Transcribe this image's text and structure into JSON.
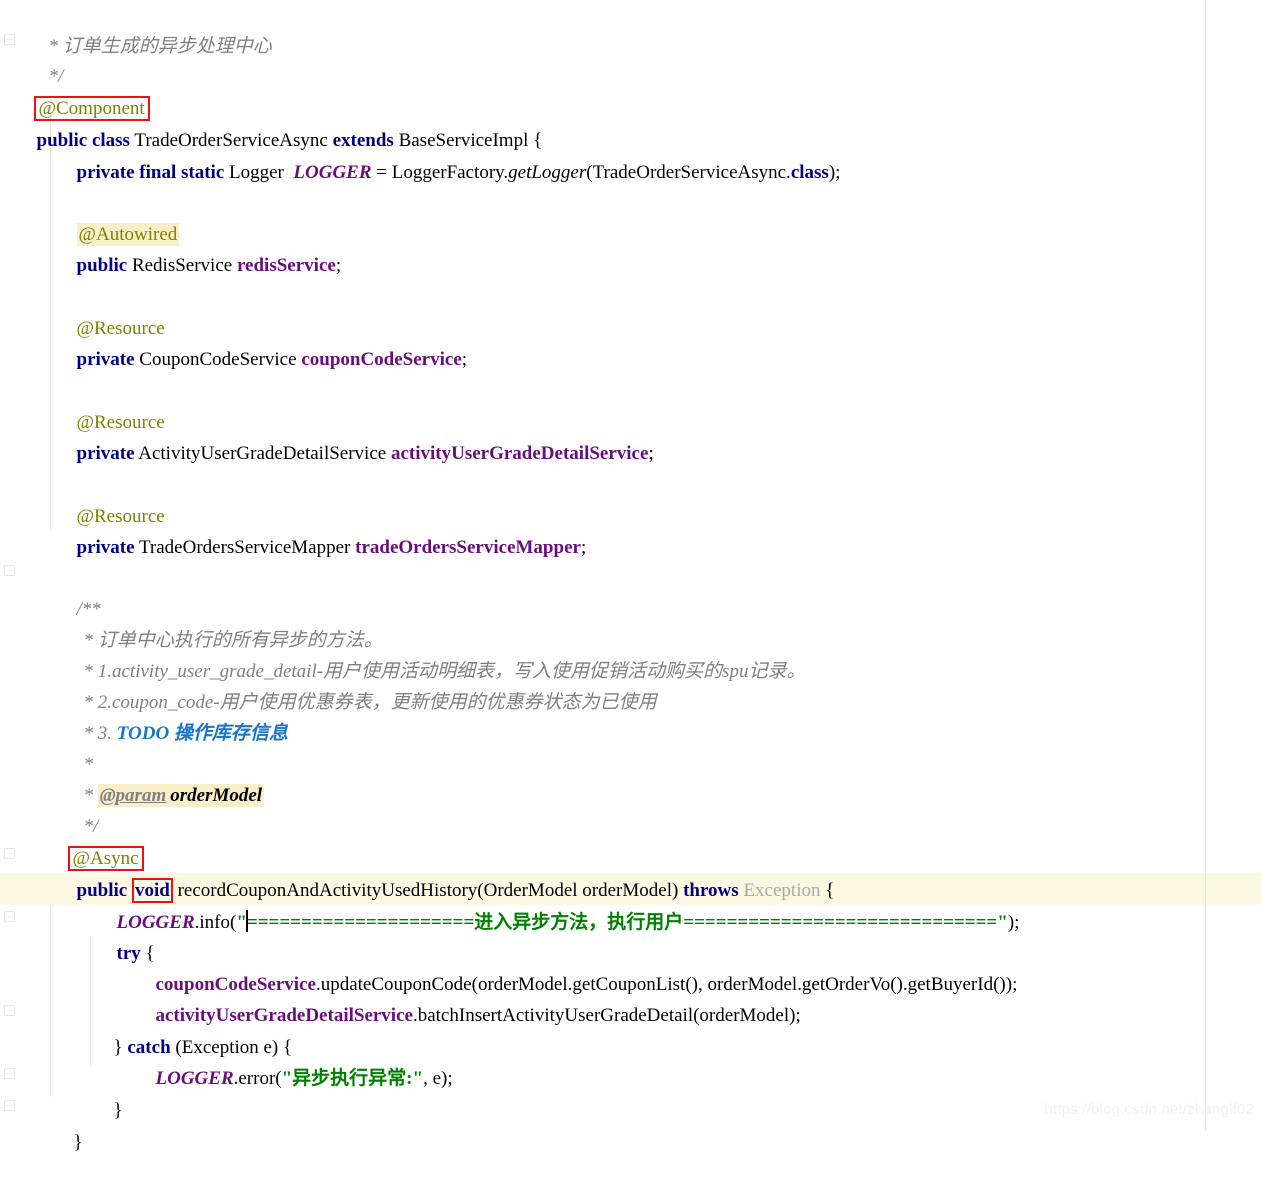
{
  "editor": {
    "language": "Java",
    "watermark": "https://blog.csdn.net/zhanglf02",
    "colors": {
      "background": "#ffffff",
      "keyword": "#000080",
      "annotation": "#808000",
      "comment": "#808080",
      "string": "#008000",
      "field": "#660e7a",
      "todo": "#1874cd",
      "highlight_background": "#faeec8",
      "current_line_background": "#fdf8e3",
      "red_box_border": "#ee1111",
      "margin_guide": "#e4e4e4",
      "watermark": "#f2f2f2"
    },
    "caret": {
      "visible": true,
      "line": "logger_info_line",
      "after_text": "LOGGER.info(\""
    }
  },
  "code": {
    "lines": [
      {
        "id": "l1",
        "indent": 1,
        "text": "* 订单生成的异步处理中心",
        "type": "comment"
      },
      {
        "id": "l2",
        "indent": 1,
        "text": "*/",
        "type": "comment"
      },
      {
        "id": "l3",
        "indent": 0,
        "text": "@Component",
        "type": "annotation",
        "boxed": true
      },
      {
        "id": "l4",
        "indent": 0,
        "text": "public class TradeOrderServiceAsync extends BaseServiceImpl {",
        "parts": {
          "public": "public",
          "class": "class",
          "classname": "TradeOrderServiceAsync",
          "extends": "extends",
          "superclass": "BaseServiceImpl",
          "brace": "{"
        }
      },
      {
        "id": "l5",
        "indent": 1,
        "text": "private final static Logger LOGGER = LoggerFactory.getLogger(TradeOrderServiceAsync.class);",
        "parts": {
          "private": "private",
          "final": "final",
          "static": "static",
          "type": "Logger",
          "name": "LOGGER",
          "eq": "=",
          "factory": "LoggerFactory.",
          "call": "getLogger",
          "open": "(",
          "arg": "TradeOrderServiceAsync.",
          "classkw": "class",
          "close": ");"
        }
      },
      {
        "id": "l6",
        "indent": 1,
        "text": "@Autowired",
        "type": "annotation",
        "highlighted": true
      },
      {
        "id": "l7",
        "indent": 1,
        "text": "public RedisService redisService;",
        "parts": {
          "mod": "public",
          "type": "RedisService",
          "name": "redisService",
          "semi": ";"
        }
      },
      {
        "id": "l8",
        "indent": 1,
        "text": "@Resource",
        "type": "annotation"
      },
      {
        "id": "l9",
        "indent": 1,
        "text": "private CouponCodeService couponCodeService;",
        "parts": {
          "mod": "private",
          "type": "CouponCodeService",
          "name": "couponCodeService",
          "semi": ";"
        }
      },
      {
        "id": "l10",
        "indent": 1,
        "text": "@Resource",
        "type": "annotation"
      },
      {
        "id": "l11",
        "indent": 1,
        "text": "private ActivityUserGradeDetailService activityUserGradeDetailService;",
        "parts": {
          "mod": "private",
          "type": "ActivityUserGradeDetailService",
          "name": "activityUserGradeDetailService",
          "semi": ";"
        }
      },
      {
        "id": "l12",
        "indent": 1,
        "text": "@Resource",
        "type": "annotation"
      },
      {
        "id": "l13",
        "indent": 1,
        "text": "private TradeOrdersServiceMapper tradeOrdersServiceMapper;",
        "parts": {
          "mod": "private",
          "type": "TradeOrdersServiceMapper",
          "name": "tradeOrdersServiceMapper",
          "semi": ";"
        }
      },
      {
        "id": "l14",
        "indent": 1,
        "text": "/**",
        "type": "comment"
      },
      {
        "id": "l15",
        "indent": 1,
        "text": "* 订单中心执行的所有异步的方法。",
        "type": "comment"
      },
      {
        "id": "l16",
        "indent": 1,
        "text": "* 1.activity_user_grade_detail-用户使用活动明细表，写入使用促销活动购买的spu记录。",
        "type": "comment"
      },
      {
        "id": "l17",
        "indent": 1,
        "text": "* 2.coupon_code-用户使用优惠券表，更新使用的优惠券状态为已使用",
        "type": "comment"
      },
      {
        "id": "l18",
        "indent": 1,
        "text": "* 3. TODO 操作库存信息",
        "type": "comment",
        "parts": {
          "star": "* 3. ",
          "todo": "TODO 操作库存信息"
        }
      },
      {
        "id": "l19",
        "indent": 1,
        "text": "*",
        "type": "comment"
      },
      {
        "id": "l20",
        "indent": 1,
        "text": "* @param orderModel",
        "type": "comment",
        "parts": {
          "star": "* ",
          "tag": "@param",
          "param": "orderModel"
        },
        "highlighted": true
      },
      {
        "id": "l21",
        "indent": 1,
        "text": "*/",
        "type": "comment"
      },
      {
        "id": "l22",
        "indent": 1,
        "text": "@Async",
        "type": "annotation",
        "boxed": true
      },
      {
        "id": "l23",
        "indent": 1,
        "text": "public void recordCouponAndActivityUsedHistory(OrderModel orderModel) throws Exception {",
        "parts": {
          "public": "public",
          "void": "void",
          "name": "recordCouponAndActivityUsedHistory",
          "open": "(",
          "paramtype": "OrderModel",
          "paramname": " orderModel",
          "close": ") ",
          "throws": "throws",
          "exception": "Exception",
          "brace": "{"
        },
        "void_boxed": true
      },
      {
        "id": "logger_info_line",
        "indent": 2,
        "text": "LOGGER.info(\"=====================进入异步方法，执行用户=============================\");",
        "parts": {
          "logger": "LOGGER",
          "dot": ".",
          "call": "info",
          "open": "(",
          "quote_open": "\"",
          "str_left": "=====================",
          "str_cn": "进入异步方法，执行用户",
          "str_right": "=============================",
          "quote_close": "\"",
          "close": ");"
        },
        "current_line": true
      },
      {
        "id": "l25",
        "indent": 2,
        "text": "try {",
        "parts": {
          "kw": "try",
          "brace": "{"
        }
      },
      {
        "id": "l26",
        "indent": 3,
        "text": "couponCodeService.updateCouponCode(orderModel.getCouponList(), orderModel.getOrderVo().getBuyerId());",
        "parts": {
          "field": "couponCodeService",
          "rest": ".updateCouponCode(orderModel.getCouponList(), orderModel.getOrderVo().getBuyerId());"
        }
      },
      {
        "id": "l27",
        "indent": 3,
        "text": "activityUserGradeDetailService.batchInsertActivityUserGradeDetail(orderModel);",
        "parts": {
          "field": "activityUserGradeDetailService",
          "rest": ".batchInsertActivityUserGradeDetail(orderModel);"
        }
      },
      {
        "id": "l28",
        "indent": 2,
        "text": "} catch (Exception e) {",
        "parts": {
          "brace": "} ",
          "kw": "catch",
          "rest": " (Exception e) {"
        }
      },
      {
        "id": "l29",
        "indent": 3,
        "text": "LOGGER.error(\"异步执行异常:\", e);",
        "parts": {
          "logger": "LOGGER",
          "dot": ".",
          "call": "error",
          "open": "(",
          "str": "\"异步执行异常:\"",
          "rest": ", e);"
        }
      },
      {
        "id": "l30",
        "indent": 2,
        "text": "}"
      },
      {
        "id": "l31",
        "indent": 0,
        "text": "}"
      }
    ]
  }
}
